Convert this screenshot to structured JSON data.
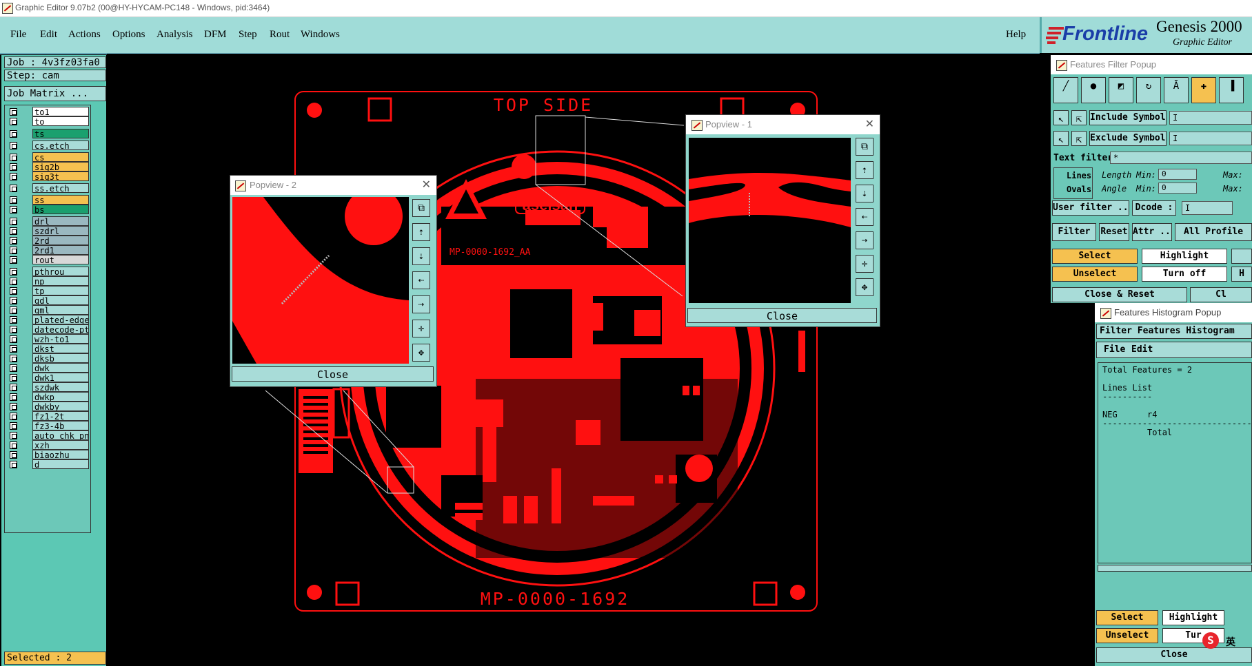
{
  "window": {
    "title": "Graphic Editor 9.07b2 (00@HY-HYCAM-PC148 - Windows, pid:3464)"
  },
  "menu": {
    "items": [
      "File",
      "Edit",
      "Actions",
      "Options",
      "Analysis",
      "DFM",
      "Step",
      "Rout",
      "Windows"
    ],
    "help": "Help"
  },
  "brand": {
    "logo": "Frontline",
    "product": "Genesis 2000",
    "subtitle": "Graphic Editor"
  },
  "left_panel": {
    "job": "Job : 4v3fz03fa0",
    "step": "Step: cam",
    "job_matrix": "Job Matrix ...",
    "layers": [
      {
        "name": "to1",
        "color": "#ffffff"
      },
      {
        "name": "to",
        "color": "#ffffff"
      },
      {
        "name": "ts",
        "color": "#1aa06e"
      },
      {
        "name": "cs.etch",
        "color": "#a8dcd8"
      },
      {
        "name": "cs",
        "color": "#f5c150"
      },
      {
        "name": "sig2b",
        "color": "#f5c150"
      },
      {
        "name": "sig3t",
        "color": "#f5c150"
      },
      {
        "name": "ss.etch",
        "color": "#a8dcd8"
      },
      {
        "name": "ss",
        "color": "#f5c150"
      },
      {
        "name": "bs",
        "color": "#1aa06e"
      },
      {
        "name": "drl",
        "color": "#9ab8c0"
      },
      {
        "name": "szdrl",
        "color": "#9ab8c0"
      },
      {
        "name": "2rd",
        "color": "#9ab8c0"
      },
      {
        "name": "2rd1",
        "color": "#9ab8c0"
      },
      {
        "name": "rout",
        "color": "#d8d8d8"
      },
      {
        "name": "pthrou",
        "color": "#a8dcd8"
      },
      {
        "name": "np",
        "color": "#a8dcd8"
      },
      {
        "name": "tp",
        "color": "#a8dcd8"
      },
      {
        "name": "gdl",
        "color": "#a8dcd8"
      },
      {
        "name": "gml",
        "color": "#a8dcd8"
      },
      {
        "name": "plated-edge",
        "color": "#a8dcd8"
      },
      {
        "name": "datecode-pt",
        "color": "#a8dcd8"
      },
      {
        "name": "wzh-to1",
        "color": "#a8dcd8"
      },
      {
        "name": "dkst",
        "color": "#a8dcd8"
      },
      {
        "name": "dksb",
        "color": "#a8dcd8"
      },
      {
        "name": "dwk",
        "color": "#a8dcd8"
      },
      {
        "name": "dwk1",
        "color": "#a8dcd8"
      },
      {
        "name": "szdwk",
        "color": "#a8dcd8"
      },
      {
        "name": "dwkp",
        "color": "#a8dcd8"
      },
      {
        "name": "dwkby",
        "color": "#a8dcd8"
      },
      {
        "name": "fz1-2t",
        "color": "#a8dcd8"
      },
      {
        "name": "fz3-4b",
        "color": "#a8dcd8"
      },
      {
        "name": "auto_chk_pn",
        "color": "#a8dcd8"
      },
      {
        "name": "xzh",
        "color": "#a8dcd8"
      },
      {
        "name": "biaozhu",
        "color": "#a8dcd8"
      },
      {
        "name": "d",
        "color": "#a8dcd8"
      }
    ],
    "selected": "Selected : 2"
  },
  "board": {
    "top_label": "TOP SIDE",
    "bottom_label": "MP-0000-1692",
    "part_label": "MP-0000-1692_AA",
    "logo_text": "aselsan"
  },
  "popview2": {
    "title": "Popview - 2",
    "close": "Close"
  },
  "popview1": {
    "title": "Popview - 1",
    "close": "Close"
  },
  "filter_popup": {
    "title": "Features Filter Popup",
    "include_symbols": "Include Symbols :",
    "exclude_symbols": "Exclude Symbols :",
    "text_filter": "Text filter",
    "text_filter_value": "*",
    "lines": "Lines",
    "ovals": "Ovals",
    "length": "Length",
    "angle": "Angle",
    "min": "Min:",
    "max": "Max:",
    "min_value": "0",
    "user_filter": "User filter ...",
    "dcode": "Dcode :",
    "filter": "Filter",
    "reset": "Reset",
    "attr": "Attr ...",
    "all_profile": "All Profile",
    "select": "Select",
    "highlight": "Highlight",
    "unselect": "Unselect",
    "turn_off": "Turn off",
    "h": "H",
    "close_reset": "Close & Reset",
    "cl": "Cl"
  },
  "histogram_popup": {
    "title": "Features Histogram Popup",
    "header": "Filter Features Histogram",
    "menu": [
      "File",
      "Edit"
    ],
    "text": [
      "Total Features = 2",
      "",
      "Lines List",
      "----------",
      "",
      "NEG      r4",
      "------------------------------------",
      "         Total"
    ],
    "select": "Select",
    "highlight": "Highlight",
    "unselect": "Unselect",
    "turn_off": "Tur",
    "close": "Close"
  },
  "ime": {
    "label": "英"
  }
}
